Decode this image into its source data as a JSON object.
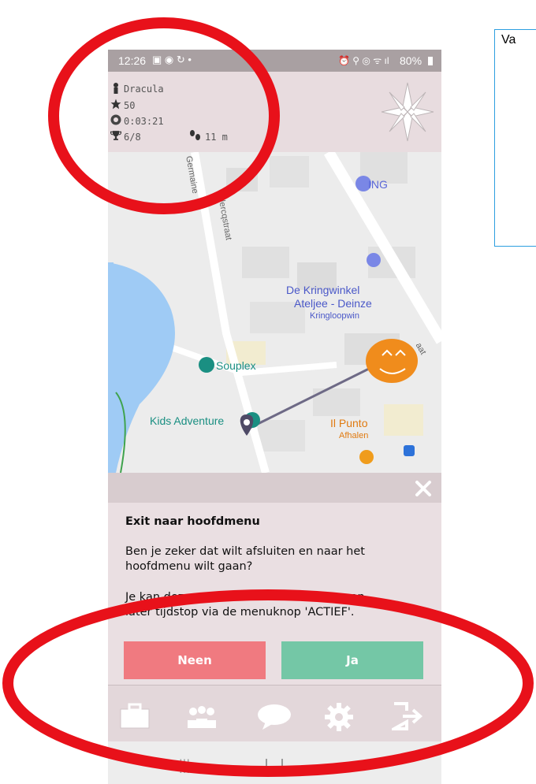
{
  "status_bar": {
    "time": "12:26",
    "battery": "80%"
  },
  "player": {
    "name": "Dracula",
    "score": "50",
    "elapsed": "0:03:21",
    "progress": "6/8",
    "distance": "11 m"
  },
  "map": {
    "labels": {
      "ing": "ING",
      "street1": "Germaine",
      "street2": "lercqstraat",
      "kringwinkel_l1": "De Kringwinkel",
      "kringwinkel_l2": "Ateljee - Deinze",
      "kringwinkel_l3": "Kringloopwin",
      "street3": "aat",
      "souplex": "Souplex",
      "kids": "Kids Adventure",
      "ilpunto": "Il Punto",
      "afhalen": "Afhalen"
    }
  },
  "dialog": {
    "title": "Exit naar hoofdmenu",
    "body_l1": "Ben je zeker dat wilt afsluiten en naar het",
    "body_l2": "hoofdmenu wilt gaan?",
    "body2_l1": "Je kan deze activiteit verderzetten op een",
    "body2_l2": "later tijdstop via de menuknop 'ACTIEF'.",
    "no_label": "Neen",
    "yes_label": "Ja"
  },
  "tabs": [
    "briefcase-icon",
    "team-icon",
    "chat-icon",
    "gear-icon",
    "exit-icon"
  ],
  "note": {
    "text": "Va"
  },
  "colors": {
    "no_button": "#f07a80",
    "yes_button": "#74c7a6",
    "annotation_red": "#e8111a",
    "note_border": "#2d9fe0",
    "route": "#6e6a86",
    "pumpkin": "#f08c1c"
  }
}
